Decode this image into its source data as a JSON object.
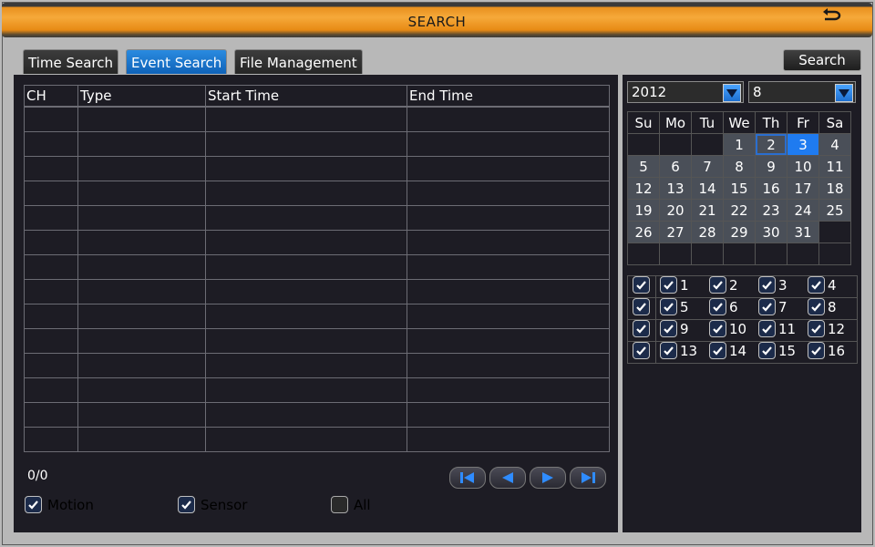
{
  "window": {
    "title": "SEARCH"
  },
  "tabs": [
    {
      "label": "Time Search",
      "active": false
    },
    {
      "label": "Event Search",
      "active": true
    },
    {
      "label": "File Management",
      "active": false
    }
  ],
  "search_button": "Search",
  "events_table": {
    "columns": [
      "CH",
      "Type",
      "Start Time",
      "End Time"
    ],
    "rows": []
  },
  "pager": {
    "counter": "0/0"
  },
  "filters": [
    {
      "label": "Motion",
      "checked": true
    },
    {
      "label": "Sensor",
      "checked": true
    },
    {
      "label": "All",
      "checked": false
    }
  ],
  "calendar": {
    "year": "2012",
    "month": "8",
    "weekdays": [
      "Su",
      "Mo",
      "Tu",
      "We",
      "Th",
      "Fr",
      "Sa"
    ],
    "weeks": [
      [
        "",
        "",
        "",
        "1",
        "2",
        "3",
        "4"
      ],
      [
        "5",
        "6",
        "7",
        "8",
        "9",
        "10",
        "11"
      ],
      [
        "12",
        "13",
        "14",
        "15",
        "16",
        "17",
        "18"
      ],
      [
        "19",
        "20",
        "21",
        "22",
        "23",
        "24",
        "25"
      ],
      [
        "26",
        "27",
        "28",
        "29",
        "30",
        "31",
        ""
      ],
      [
        "",
        "",
        "",
        "",
        "",
        "",
        ""
      ]
    ],
    "today": "2",
    "selected": "3"
  },
  "channels": {
    "rows": [
      [
        "1",
        "2",
        "3",
        "4"
      ],
      [
        "5",
        "6",
        "7",
        "8"
      ],
      [
        "9",
        "10",
        "11",
        "12"
      ],
      [
        "13",
        "14",
        "15",
        "16"
      ]
    ],
    "all_checked": true
  },
  "colors": {
    "title_bar": "#f0a030",
    "active_tab": "#1a74cc",
    "panel_bg": "#1d1c24",
    "selected_day": "#1f7bf0"
  }
}
